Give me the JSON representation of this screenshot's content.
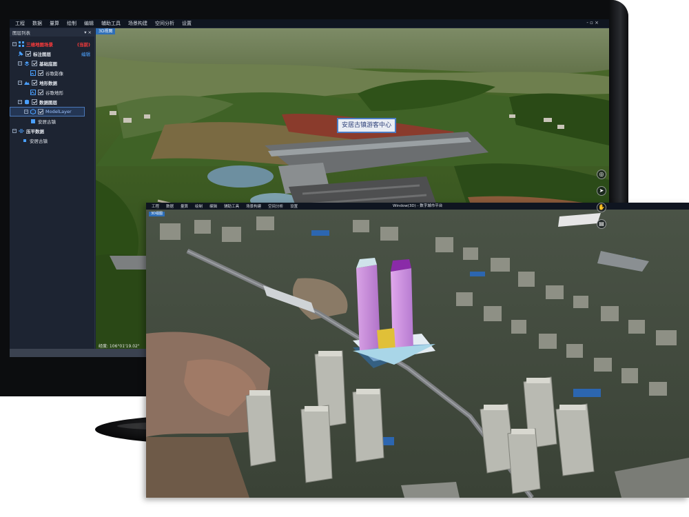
{
  "monitor_app": {
    "menu": [
      "工程",
      "数据",
      "量算",
      "绘制",
      "编辑",
      "辅助工具",
      "场景构建",
      "空间分析",
      "设置"
    ],
    "window_controls": "- ▫ ×",
    "layer_panel": {
      "title": "图层列表",
      "header_controls": "▾ ×",
      "nodes": [
        {
          "label": "三维地图场景",
          "tag": "(当前)"
        },
        {
          "label": "标注图层",
          "action": "编辑"
        },
        {
          "label": "基础底图"
        },
        {
          "label": "谷歌影像"
        },
        {
          "label": "地形数据"
        },
        {
          "label": "谷歌地形"
        },
        {
          "label": "数据图层"
        },
        {
          "label": "ModelLayer"
        },
        {
          "label": "安居古镇"
        },
        {
          "label": "压平数据"
        },
        {
          "label": "安居古镇"
        }
      ]
    },
    "view_tab": "3D视图",
    "sign_text": "安居古镇游客中心",
    "coordinates": "经度: 106°01'19.02\"",
    "tools": [
      "globe-icon",
      "compass-icon",
      "hand-icon",
      "layers-icon"
    ]
  },
  "front_app": {
    "menu": [
      "工程",
      "数据",
      "量算",
      "绘制",
      "编辑",
      "辅助工具",
      "场景构建",
      "空间分析",
      "设置"
    ],
    "title": "Window(3D) - 数字城市平台",
    "view_tab": "3D视图"
  },
  "colors": {
    "panel_bg": "#1d2432",
    "menubar_bg": "#0f1520",
    "accent_blue": "#2f6fb8",
    "alert_red": "#ff3b3b",
    "link_blue": "#4da3ff"
  }
}
